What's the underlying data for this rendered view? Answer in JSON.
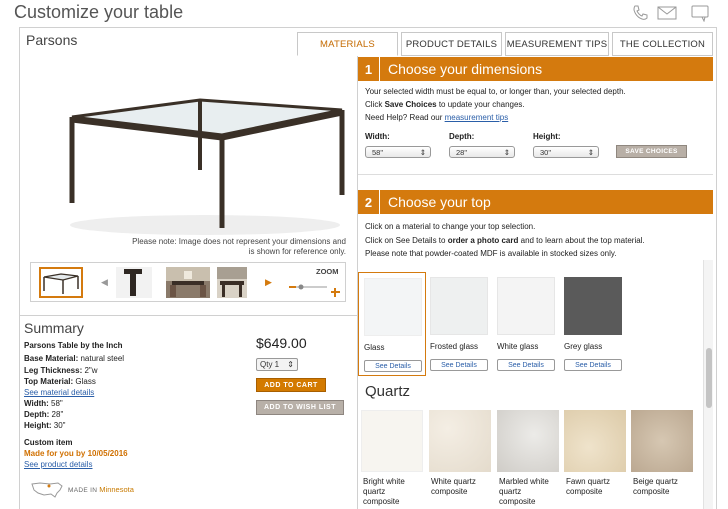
{
  "header": {
    "title": "Customize your table",
    "icons": [
      "phone-icon",
      "mail-icon",
      "chat-icon"
    ]
  },
  "product": {
    "name": "Parsons",
    "image_note": "Please note: Image does not represent your dimensions and is shown for reference only.",
    "zoom_label": "ZOOM"
  },
  "tabs": [
    {
      "label": "MATERIALS",
      "active": true
    },
    {
      "label": "PRODUCT DETAILS",
      "active": false
    },
    {
      "label": "MEASUREMENT TIPS",
      "active": false
    },
    {
      "label": "THE COLLECTION",
      "active": false
    }
  ],
  "summary": {
    "title": "Summary",
    "subtitle": "Parsons Table by the Inch",
    "base_label": "Base Material:",
    "base_value": " natural steel",
    "leg_label": "Leg Thickness:",
    "leg_value": " 2\"w",
    "top_label": "Top Material:",
    "top_value": " Glass",
    "material_link": "See material details",
    "width_label": "Width:",
    "width_value": " 58\"",
    "depth_label": "Depth:",
    "depth_value": " 28\"",
    "height_label": "Height:",
    "height_value": " 30\"",
    "custom_label": "Custom item",
    "made_for": "Made for you by 10/05/2016",
    "product_link": "See product details",
    "price": "$649.00",
    "qty": "Qty 1",
    "add_to_cart": "ADD TO CART",
    "add_to_wishlist": "ADD TO WISH LIST",
    "made_in_prefix": "MADE IN",
    "made_in_state": "Minnesota"
  },
  "dimensions": {
    "num": "1",
    "title": "Choose your dimensions",
    "line1": "Your selected width must be equal to, or longer than, your selected depth.",
    "line2_pre": "Click ",
    "line2_bold": "Save Choices",
    "line2_post": " to update your changes.",
    "help_pre": "Need Help? Read our ",
    "help_link": "measurement tips",
    "width_label": "Width:",
    "width_value": "58\"",
    "depth_label": "Depth:",
    "depth_value": "28\"",
    "height_label": "Height:",
    "height_value": "30\"",
    "save_label": "SAVE CHOICES"
  },
  "top": {
    "num": "2",
    "title": "Choose your top",
    "line1": "Click on a material to change your top selection.",
    "line2_pre": "Click on See Details to ",
    "line2_bold": "order a photo card",
    "line2_post": " and to learn about the top material.",
    "line3": "Please note that powder-coated MDF is available in stocked sizes only.",
    "see_details": "See Details",
    "glass": [
      {
        "name": "Glass",
        "color": "#f3f5f6",
        "selected": true
      },
      {
        "name": "Frosted glass",
        "color": "#eef0f0",
        "selected": false
      },
      {
        "name": "White glass",
        "color": "#f4f4f4",
        "selected": false
      },
      {
        "name": "Grey glass",
        "color": "#5a5a5a",
        "selected": false
      }
    ],
    "quartz_title": "Quartz",
    "quartz": [
      {
        "name": "Bright white\nquartz\ncomposite",
        "color": "#f7f5f0"
      },
      {
        "name": "White quartz\ncomposite",
        "color": "#ede6da"
      },
      {
        "name": "Marbled white\nquartz\ncomposite",
        "color": "#dcdad6"
      },
      {
        "name": "Fawn quartz\ncomposite",
        "color": "#e6d7bb"
      },
      {
        "name": "Beige quartz\ncomposite",
        "color": "#c9b8a2"
      }
    ]
  },
  "colors": {
    "accent": "#d47a0e",
    "link": "#2a5ea8"
  }
}
